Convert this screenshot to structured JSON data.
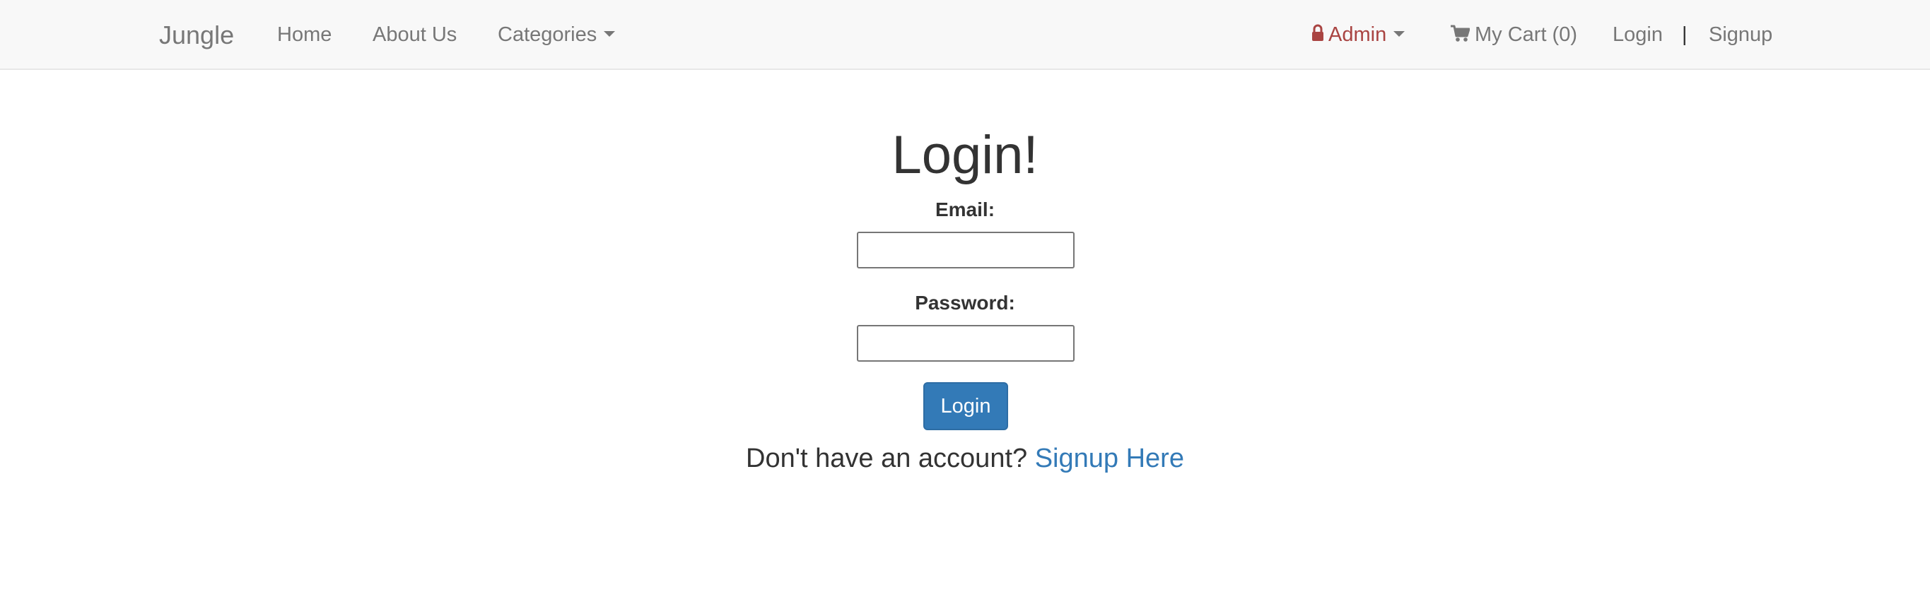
{
  "navbar": {
    "brand": "Jungle",
    "links": {
      "home": "Home",
      "about": "About Us",
      "categories": "Categories"
    },
    "admin_label": "Admin",
    "cart_label": "My Cart (0)",
    "login": "Login",
    "separator": "|",
    "signup": "Signup"
  },
  "login_form": {
    "title": "Login!",
    "email_label": "Email:",
    "email_value": "",
    "password_label": "Password:",
    "password_value": "",
    "submit_label": "Login",
    "signup_prompt": "Don't have an account?",
    "signup_link": "Signup Here"
  },
  "colors": {
    "navbar_bg": "#f8f8f8",
    "nav_text": "#777777",
    "admin": "#a94442",
    "primary": "#337ab7",
    "text": "#333333"
  },
  "icons": {
    "admin": "lock-icon",
    "cart": "shopping-cart-icon",
    "dropdown": "caret-down-icon"
  }
}
